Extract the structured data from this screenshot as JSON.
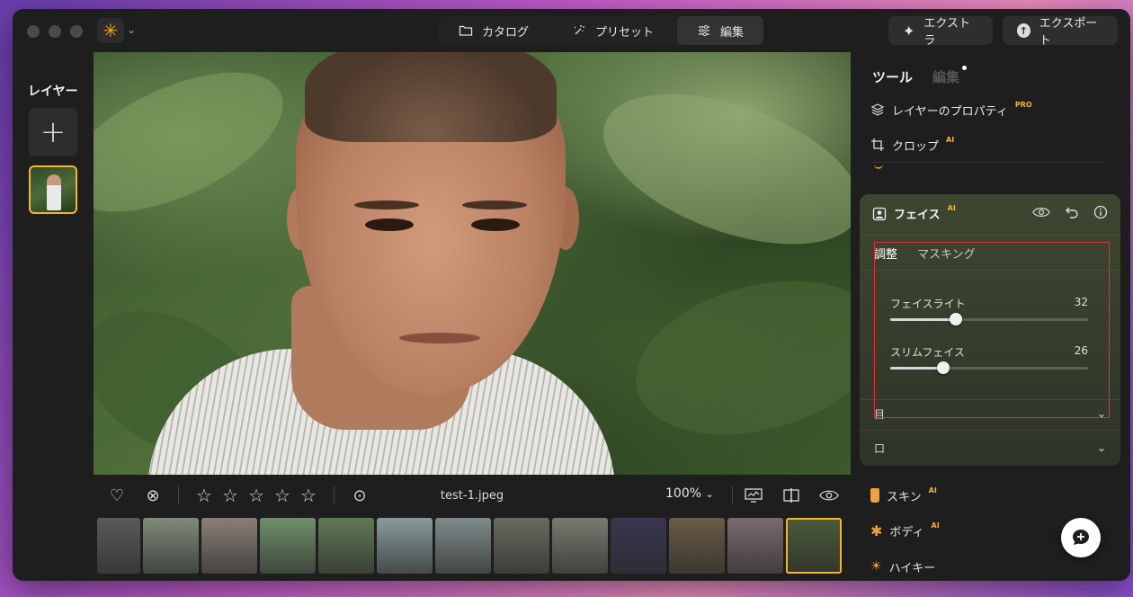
{
  "topbar": {
    "tabs": [
      {
        "label": "カタログ",
        "icon": "folder-icon"
      },
      {
        "label": "プリセット",
        "icon": "sparkle-wand-icon"
      },
      {
        "label": "編集",
        "icon": "sliders-icon",
        "active": true
      }
    ],
    "extra_label": "エクストラ",
    "export_label": "エクスポート"
  },
  "layers": {
    "title": "レイヤー",
    "add_label": "+"
  },
  "photo": {
    "filename": "test-1.jpeg",
    "zoom": "100%",
    "rating_stars": 0
  },
  "filmstrip": {
    "thumbs": [
      "#5a5a58",
      "#7f8a78",
      "#8a7f78",
      "#6f8f6a",
      "#5f7a55",
      "#8a9a9a",
      "#7f8a8a",
      "#6a6a60",
      "#7a7a70",
      "#3a3550",
      "#6a5a48",
      "#7a6a70",
      "#4a5a38"
    ],
    "selected_index": 12
  },
  "right_panel": {
    "tab_tools": "ツール",
    "tab_edit": "編集",
    "tools": [
      {
        "label": "レイヤーのプロパティ",
        "badge": "PRO",
        "icon": "layers-icon"
      },
      {
        "label": "クロップ",
        "badge": "AI",
        "icon": "crop-icon"
      }
    ],
    "face": {
      "title": "フェイス",
      "badge": "AI",
      "subtab_adjust": "調整",
      "subtab_masking": "マスキング",
      "sliders": [
        {
          "label": "フェイスライト",
          "value": 32,
          "fraction": 0.33
        },
        {
          "label": "スリムフェイス",
          "value": 26,
          "fraction": 0.27
        }
      ],
      "section_eye": "目",
      "section_mouth": "口"
    },
    "lower_tools": [
      {
        "label": "スキン",
        "badge": "AI",
        "icon": "skin-bottle-icon"
      },
      {
        "label": "ボディ",
        "badge": "AI",
        "icon": "body-figure-icon"
      },
      {
        "label": "ハイキー",
        "badge": "",
        "icon": "sun-icon"
      }
    ]
  },
  "colors": {
    "accent": "#f5b52e",
    "highlight_box": "#e0303a",
    "window_bg": "#1e1e1e"
  }
}
